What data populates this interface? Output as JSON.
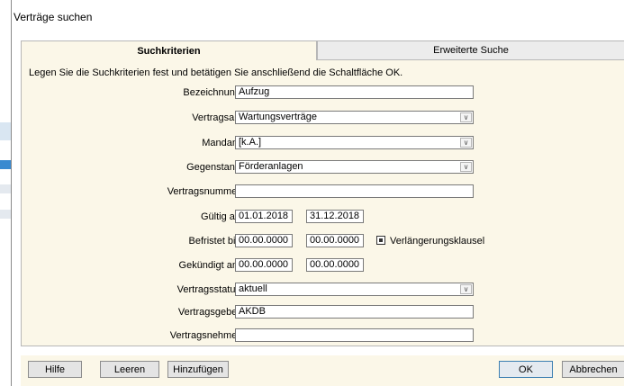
{
  "window": {
    "title": "Verträge suchen"
  },
  "tabs": [
    {
      "label": "Suchkriterien",
      "active": true
    },
    {
      "label": "Erweiterte Suche",
      "active": false
    }
  ],
  "instruction": "Legen Sie die Suchkriterien fest und betätigen Sie anschließend die Schaltfläche OK.",
  "fields": {
    "bezeichnung": {
      "label": "Bezeichnung",
      "value": "Aufzug"
    },
    "vertragsart": {
      "label": "Vertragsart",
      "value": "Wartungsverträge"
    },
    "mandant": {
      "label": "Mandant",
      "value": "[k.A.]"
    },
    "gegenstand": {
      "label": "Gegenstand",
      "value": "Förderanlagen"
    },
    "vertragsnummer": {
      "label": "Vertragsnummer",
      "value": ""
    },
    "gueltig_ab": {
      "label": "Gültig ab",
      "from": "01.01.2018",
      "to": "31.12.2018"
    },
    "befristet_bis": {
      "label": "Befristet bis",
      "from": "00.00.0000",
      "to": "00.00.0000"
    },
    "gekuendigt_am": {
      "label": "Gekündigt am",
      "from": "00.00.0000",
      "to": "00.00.0000"
    },
    "vertragsstatus": {
      "label": "Vertragsstatus",
      "value": "aktuell"
    },
    "vertragsgeber": {
      "label": "Vertragsgeber",
      "value": "AKDB"
    },
    "vertragsnehmer": {
      "label": "Vertragsnehmer",
      "value": ""
    }
  },
  "verlaengerungsklausel": {
    "label": "Verlängerungsklausel",
    "checked": true
  },
  "buttons": {
    "hilfe": "Hilfe",
    "leeren": "Leeren",
    "hinzufuegen": "Hinzufügen",
    "ok": "OK",
    "abbrechen": "Abbrechen"
  },
  "icons": {
    "dropdown": "chevron-down-icon",
    "checkbox": "checkbox-icon"
  },
  "colors": {
    "panel_bg": "#fbf7e8",
    "ok_border": "#3c7fb1"
  }
}
